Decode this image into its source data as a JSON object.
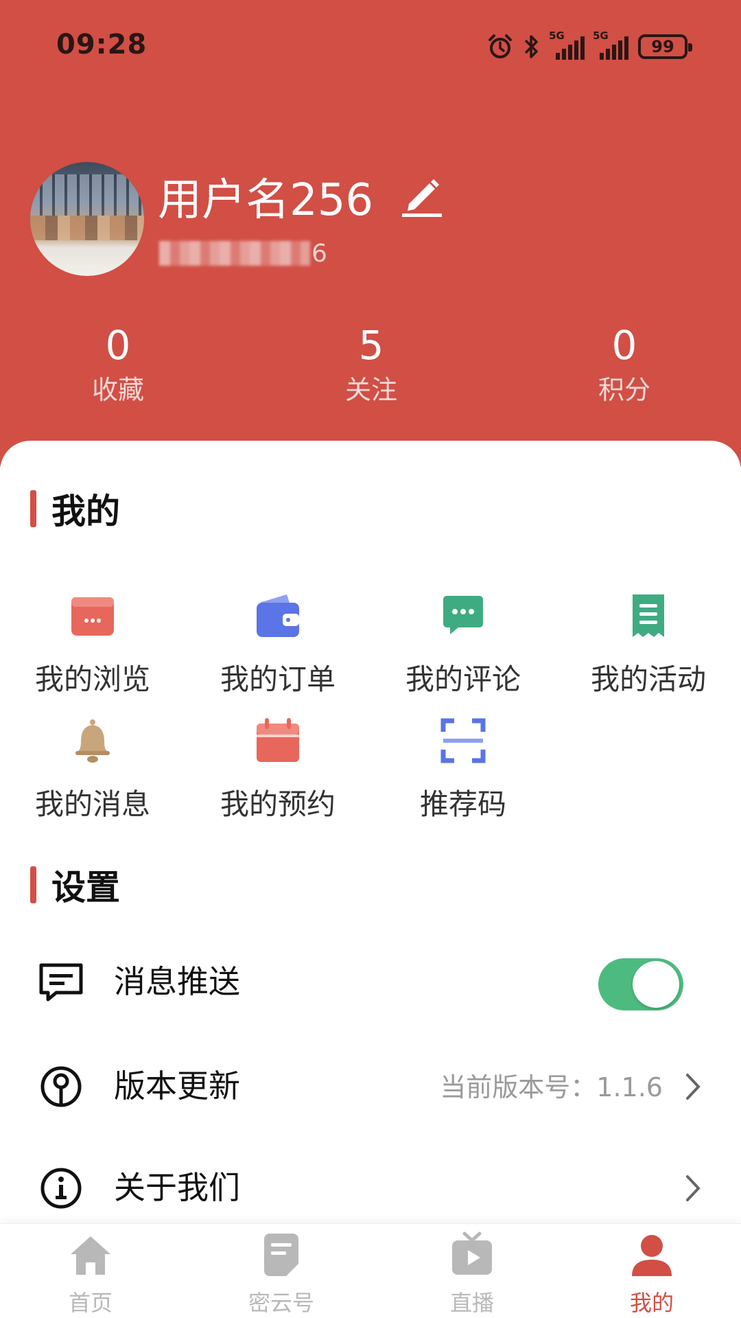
{
  "status_bar": {
    "time": "09:28",
    "network_1": "5G",
    "network_2": "5G",
    "battery": "99"
  },
  "profile": {
    "username": "用户名256",
    "phone_suffix": "6",
    "stats": [
      {
        "value": "0",
        "label": "收藏"
      },
      {
        "value": "5",
        "label": "关注"
      },
      {
        "value": "0",
        "label": "积分"
      }
    ]
  },
  "mine_section": {
    "title": "我的",
    "items": [
      {
        "label": "我的浏览",
        "icon": "browse-card-icon",
        "color": "#e8675c"
      },
      {
        "label": "我的订单",
        "icon": "wallet-icon",
        "color": "#5b74e6"
      },
      {
        "label": "我的评论",
        "icon": "comment-bubble-icon",
        "color": "#3fab82"
      },
      {
        "label": "我的活动",
        "icon": "receipt-icon",
        "color": "#3fab82"
      },
      {
        "label": "我的消息",
        "icon": "bell-icon",
        "color": "#c9a57c"
      },
      {
        "label": "我的预约",
        "icon": "calendar-icon",
        "color": "#e8675c"
      },
      {
        "label": "推荐码",
        "icon": "scan-code-icon",
        "color": "#5b74e6"
      }
    ]
  },
  "settings_section": {
    "title": "设置",
    "rows": [
      {
        "label": "消息推送",
        "icon": "message-icon",
        "toggle_on": true
      },
      {
        "label": "版本更新",
        "icon": "update-icon",
        "value": "当前版本号：1.1.6"
      },
      {
        "label": "关于我们",
        "icon": "info-icon"
      }
    ]
  },
  "bottom_nav": {
    "items": [
      {
        "label": "首页",
        "icon": "home-icon",
        "active": false
      },
      {
        "label": "密云号",
        "icon": "document-icon",
        "active": false
      },
      {
        "label": "直播",
        "icon": "tv-play-icon",
        "active": false
      },
      {
        "label": "我的",
        "icon": "person-icon",
        "active": true
      }
    ],
    "active_color": "#d14f45",
    "inactive_color": "#b8b8b8"
  },
  "theme": {
    "primary": "#d14f45",
    "toggle_on": "#4dbb7f"
  }
}
